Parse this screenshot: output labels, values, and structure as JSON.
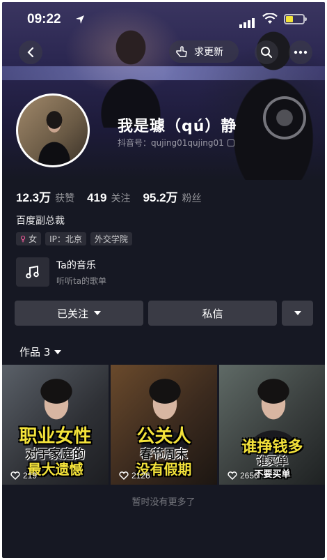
{
  "status_bar": {
    "time": "09:22"
  },
  "header": {
    "update_request_label": "求更新"
  },
  "profile": {
    "nickname": "我是璩（qú）静",
    "account_id": "抖音号：qujing01qujing01",
    "stats": [
      {
        "value": "12.3万",
        "label": "获赞"
      },
      {
        "value": "419",
        "label": "关注"
      },
      {
        "value": "95.2万",
        "label": "粉丝"
      }
    ],
    "bio": "百度副总裁",
    "tags": [
      {
        "label": "女",
        "icon": "female-icon"
      },
      {
        "label": "IP：北京"
      },
      {
        "label": "外交学院"
      }
    ]
  },
  "music": {
    "title": "Ta的音乐",
    "subtitle": "听听ta的歌单"
  },
  "actions": {
    "followed_label": "已关注",
    "message_label": "私信"
  },
  "works": {
    "label": "作品 3",
    "items": [
      {
        "line1": "职业女性",
        "line2": "对于家庭的",
        "line3": "最大遗憾",
        "likes": "219",
        "line1_color": "#f3e23a",
        "line3_color": "#f3e23a"
      },
      {
        "line1": "公关人",
        "line2": "春节周末",
        "line3": "没有假期",
        "likes": "2126",
        "line1_color": "#f3e23a",
        "line3_color": "#f3e23a"
      },
      {
        "line1": "谁挣钱多",
        "line2": "谁买单",
        "line3": "不要买单",
        "likes": "2656",
        "line1_color": "#f3e23a",
        "line3_color": "#ffffff"
      }
    ]
  },
  "footer": {
    "text": "暂时没有更多了"
  },
  "colors": {
    "background": "#161823",
    "button": "#3a3b45",
    "highlight": "#f3e23a",
    "gender_female": "#ff5fa2"
  }
}
